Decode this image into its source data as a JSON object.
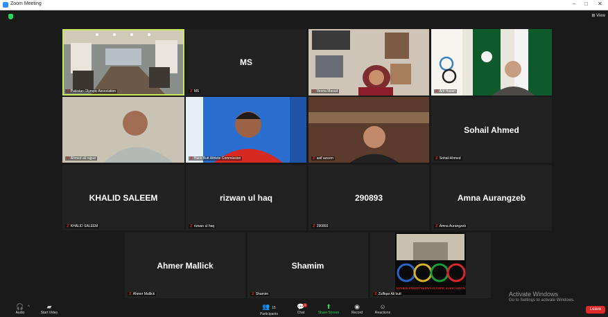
{
  "window": {
    "title": "Zoom Meeting",
    "minimize": "–",
    "maximize": "□",
    "close": "✕"
  },
  "view_button": "⊞ View",
  "tiles": [
    {
      "label": "Pakistan Olympic Association",
      "big": "",
      "video": "room"
    },
    {
      "label": "MS",
      "big": "MS",
      "video": ""
    },
    {
      "label": "Veena Masud",
      "big": "",
      "video": "woman"
    },
    {
      "label": "Arif Hasan",
      "big": "",
      "video": "flags"
    },
    {
      "label": "Ahmed ali rajput",
      "big": "",
      "video": "man1"
    },
    {
      "label": "Haris Butt Athlete Commission",
      "big": "",
      "video": "man2"
    },
    {
      "label": "asif azeem",
      "big": "",
      "video": "man3"
    },
    {
      "label": "Sohail Ahmed",
      "big": "Sohail Ahmed",
      "video": ""
    },
    {
      "label": "KHALID SALEEM",
      "big": "KHALID SALEEM",
      "video": ""
    },
    {
      "label": "rizwan ul haq",
      "big": "rizwan ul haq",
      "video": ""
    },
    {
      "label": "290893",
      "big": "290893",
      "video": ""
    },
    {
      "label": "Amna Aurangzeb",
      "big": "Amna Aurangzeb",
      "video": ""
    },
    {
      "label": "Ahmer Mallick",
      "big": "Ahmer Mallick",
      "video": ""
    },
    {
      "label": "Shamim",
      "big": "Shamim",
      "video": ""
    },
    {
      "label": "Zulfiqar Ali butt",
      "big": "",
      "video": "logo"
    }
  ],
  "logo_text": "KHYBER PAKHTUNKHWA OLYMPIC ASSOCIATION",
  "activate": {
    "line1": "Activate Windows",
    "line2": "Go to Settings to activate Windows."
  },
  "toolbar": {
    "audio": "Audio",
    "start_video": "Start Video",
    "participants": "Participants",
    "participants_count": "15",
    "chat": "Chat",
    "chat_badge": "2",
    "share_screen": "Share Screen",
    "record": "Record",
    "reactions": "Reactions",
    "leave": "Leave"
  },
  "colors": {
    "active_speaker": "#c9e85a",
    "share": "#23d959",
    "leave": "#e02828",
    "mic_muted": "#e02828"
  }
}
